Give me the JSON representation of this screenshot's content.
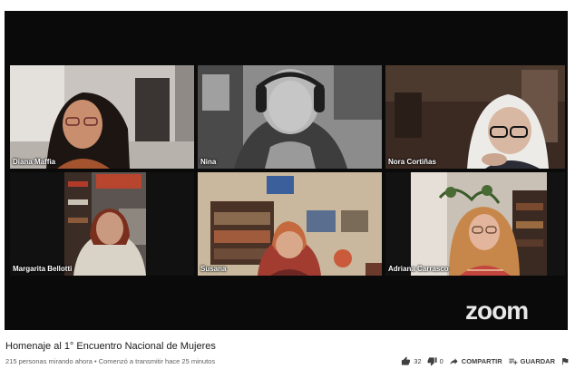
{
  "participants": [
    {
      "name": "Diana Maffia",
      "active": false
    },
    {
      "name": "Nina",
      "active": false
    },
    {
      "name": "Nora Cortiñas",
      "active": false
    },
    {
      "name": "Margarita Bellotti",
      "active": false
    },
    {
      "name": "Susana",
      "active": false
    },
    {
      "name": "Adriana Carrasco",
      "active": true
    }
  ],
  "zoom_logo": "zoom",
  "video_title": "Homenaje al 1° Encuentro Nacional de Mujeres",
  "meta_text": "215 personas mirando ahora • Comenzó a transmitir hace 25 minutos",
  "actions": {
    "like_count": "32",
    "dislike_count": "0",
    "share_label": "COMPARTIR",
    "save_label": "GUARDAR"
  },
  "colors": {
    "active_speaker": "#5fd14f",
    "video_bg": "#0a0a0a"
  },
  "icons": [
    "thumbs-up-icon",
    "thumbs-down-icon",
    "share-icon",
    "save-playlist-icon",
    "flag-icon"
  ]
}
